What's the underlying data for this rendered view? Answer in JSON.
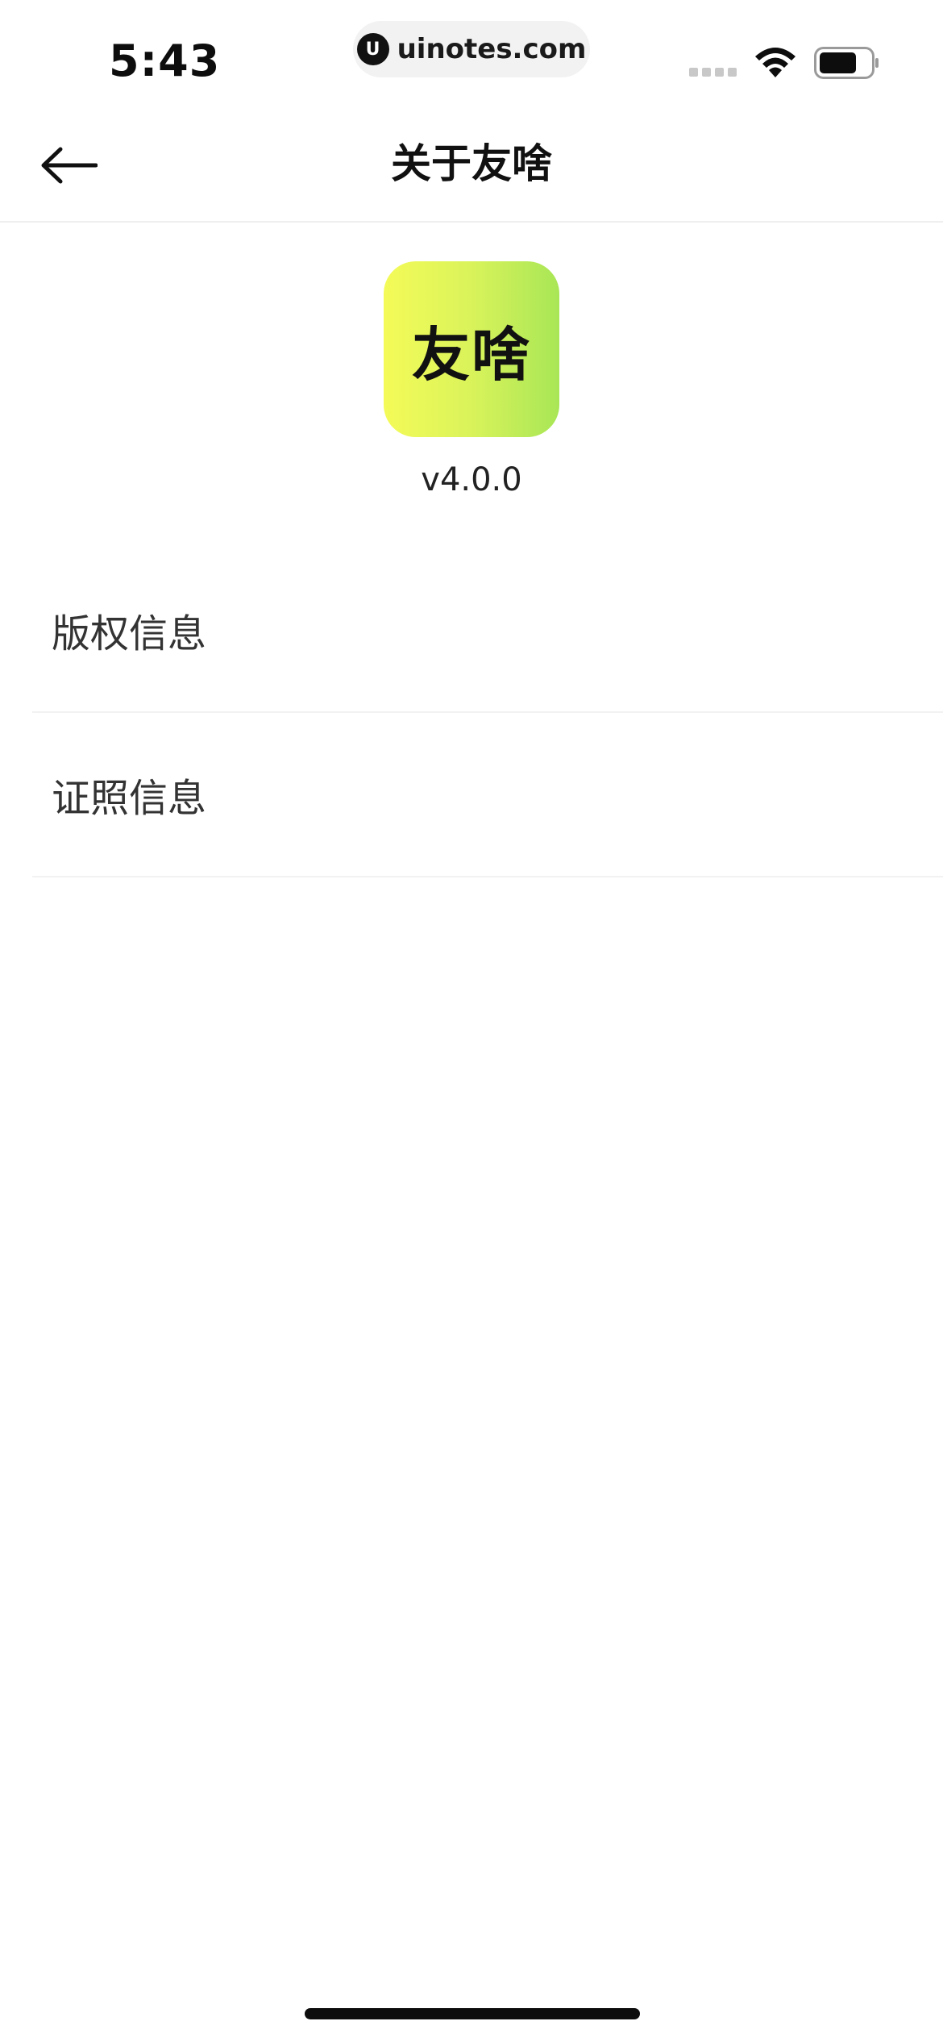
{
  "status_bar": {
    "time": "5:43",
    "url": "uinotes.com",
    "url_logo_glyph": "U",
    "icons": [
      "signal-icon",
      "wifi-icon",
      "battery-icon"
    ]
  },
  "nav": {
    "back_icon": "arrow-left-icon",
    "title": "关于友啥"
  },
  "app": {
    "logo_text": "友啥",
    "version": "v4.0.0"
  },
  "list": {
    "items": [
      {
        "label": "版权信息"
      },
      {
        "label": "证照信息"
      }
    ]
  },
  "colors": {
    "logo_gradient_start": "#f4fb58",
    "logo_gradient_end": "#a8e656",
    "text_primary": "#111111",
    "divider": "#f2f2f2"
  }
}
